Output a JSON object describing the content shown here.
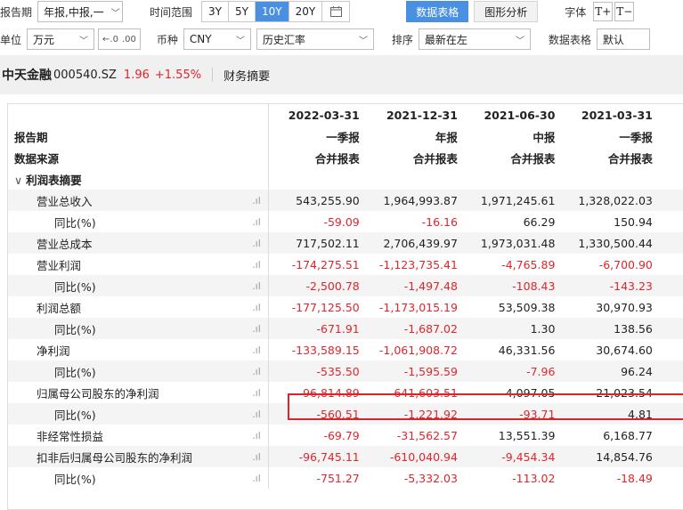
{
  "toolbar1": {
    "report_period_label": "报告期",
    "report_period_value": "年报,中报,一",
    "time_range_label": "时间范围",
    "time_range_options": [
      "3Y",
      "5Y",
      "10Y",
      "20Y"
    ],
    "time_range_selected": "10Y",
    "calendar_icon": "calendar-icon",
    "view_tab_table": "数据表格",
    "view_tab_chart": "图形分析",
    "font_label": "字体",
    "font_increase": "T+",
    "font_decrease": "T−"
  },
  "toolbar2": {
    "unit_label": "单位",
    "unit_value": "万元",
    "decimal_icon": ".00",
    "currency_label": "币种",
    "currency_value": "CNY",
    "rate_value": "历史汇率",
    "sort_label": "排序",
    "sort_value": "最新在左",
    "table_label": "数据表格",
    "table_value": "默认"
  },
  "stock": {
    "name": "中天金融",
    "code": "000540.SZ",
    "price": "1.96",
    "change_pct": "+1.55%",
    "section": "财务摘要"
  },
  "colors": {
    "accent": "#4a90e2",
    "negative": "#e0252b",
    "highlight_border": "#d9262c"
  },
  "table": {
    "columns": [
      "2022-03-31",
      "2021-12-31",
      "2021-06-30",
      "2021-03-31"
    ],
    "rows": [
      {
        "name": "报告期",
        "values": [
          "一季报",
          "年报",
          "中报",
          "一季报"
        ],
        "bold": true
      },
      {
        "name": "数据来源",
        "values": [
          "合并报表",
          "合并报表",
          "合并报表",
          "合并报表"
        ],
        "bold": true
      },
      {
        "name": "利润表摘要",
        "values": [
          "",
          "",
          "",
          ""
        ],
        "bold": true,
        "section": true
      },
      {
        "name": "营业总收入",
        "values": [
          "543,255.90",
          "1,964,993.87",
          "1,971,245.61",
          "1,328,022.03"
        ]
      },
      {
        "name": "同比(%)",
        "values": [
          "-59.09",
          "-16.16",
          "66.29",
          "150.94"
        ],
        "sub": true
      },
      {
        "name": "营业总成本",
        "values": [
          "717,502.11",
          "2,706,439.97",
          "1,973,031.48",
          "1,330,500.44"
        ]
      },
      {
        "name": "营业利润",
        "values": [
          "-174,275.51",
          "-1,123,735.41",
          "-4,765.89",
          "-6,700.90"
        ]
      },
      {
        "name": "同比(%)",
        "values": [
          "-2,500.78",
          "-1,497.48",
          "-108.43",
          "-143.23"
        ],
        "sub": true
      },
      {
        "name": "利润总额",
        "values": [
          "-177,125.50",
          "-1,173,015.19",
          "53,509.38",
          "30,970.93"
        ]
      },
      {
        "name": "同比(%)",
        "values": [
          "-671.91",
          "-1,687.02",
          "1.30",
          "138.56"
        ],
        "sub": true
      },
      {
        "name": "净利润",
        "values": [
          "-133,589.15",
          "-1,061,908.72",
          "46,331.56",
          "30,674.60"
        ]
      },
      {
        "name": "同比(%)",
        "values": [
          "-535.50",
          "-1,595.59",
          "-7.96",
          "96.24"
        ],
        "sub": true
      },
      {
        "name": "归属母公司股东的净利润",
        "values": [
          "-96,814.89",
          "-641,603.51",
          "4,097.05",
          "21,023.54"
        ]
      },
      {
        "name": "同比(%)",
        "values": [
          "-560.51",
          "-1,221.92",
          "-93.71",
          "4.81"
        ],
        "sub": true
      },
      {
        "name": "非经常性损益",
        "values": [
          "-69.79",
          "-31,562.57",
          "13,551.39",
          "6,168.77"
        ]
      },
      {
        "name": "扣非后归属母公司股东的净利润",
        "values": [
          "-96,745.11",
          "-610,040.94",
          "-9,454.34",
          "14,854.76"
        ]
      },
      {
        "name": "同比(%)",
        "values": [
          "-751.27",
          "-5,332.03",
          "-113.02",
          "-18.49"
        ],
        "sub": true
      }
    ]
  }
}
